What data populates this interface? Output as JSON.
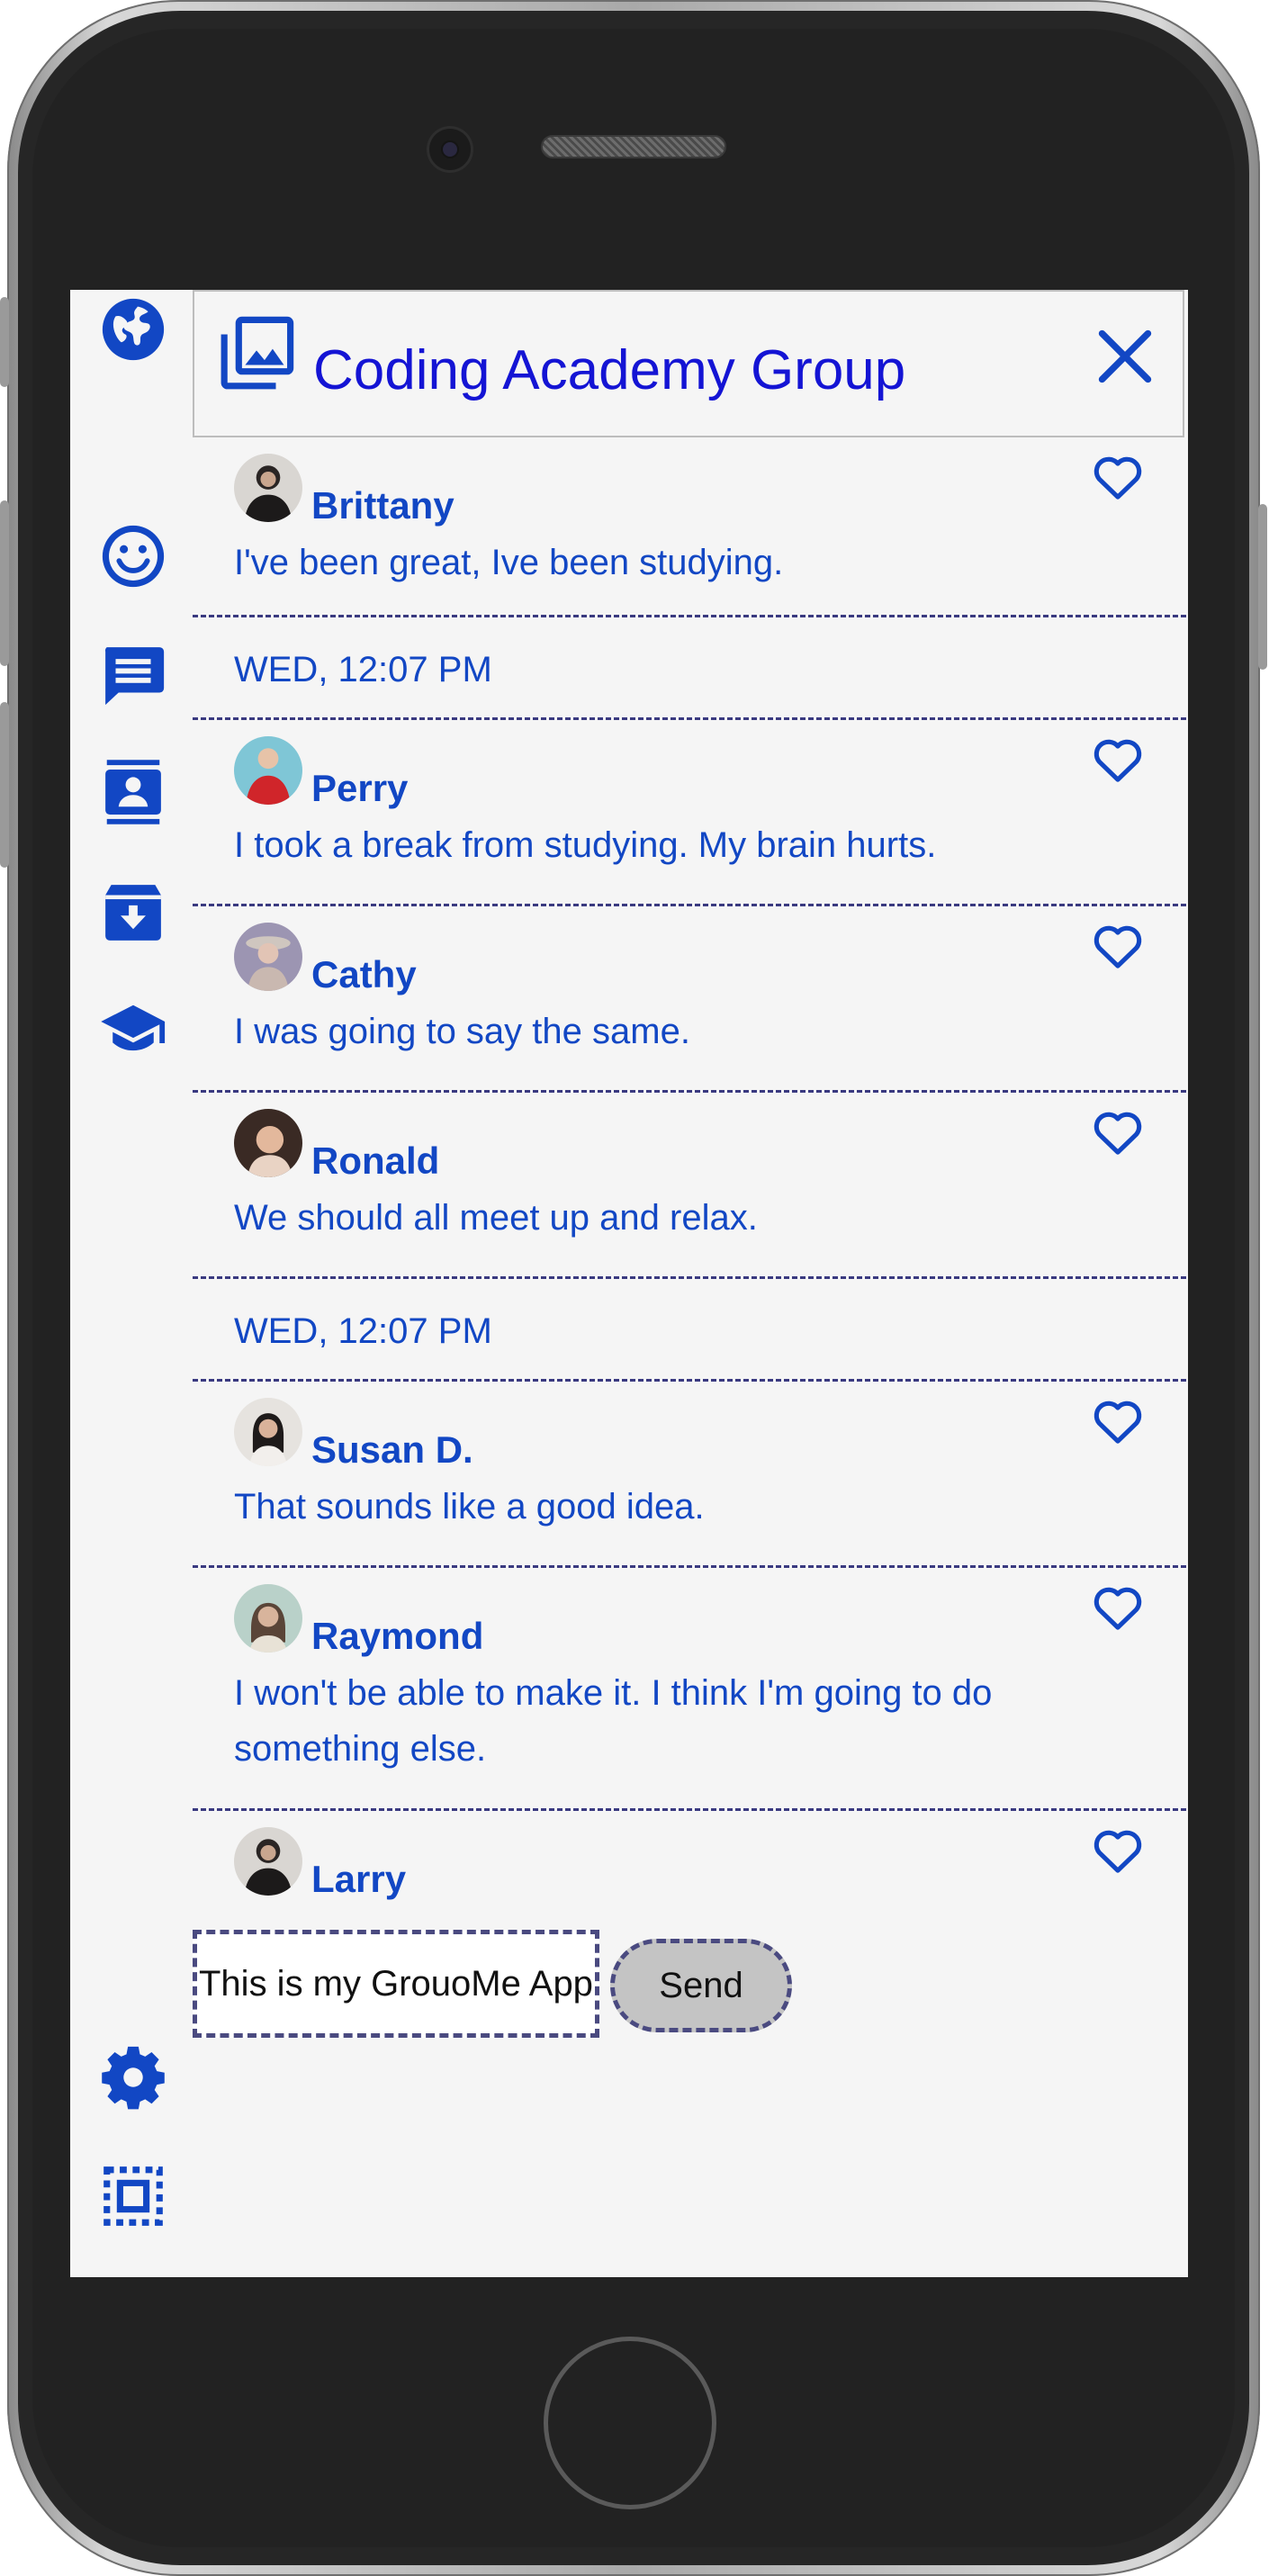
{
  "header": {
    "title": "Coding Academy Group"
  },
  "sidebar": {
    "items": [
      {
        "icon": "globe-icon"
      },
      {
        "icon": "smiley-icon"
      },
      {
        "icon": "chat-icon"
      },
      {
        "icon": "contacts-icon"
      },
      {
        "icon": "archive-icon"
      },
      {
        "icon": "graduation-cap-icon"
      },
      {
        "icon": "gear-icon"
      },
      {
        "icon": "selection-icon"
      }
    ]
  },
  "colors": {
    "accent": "#1247c4",
    "title": "#1414d4",
    "background": "#f5f5f5",
    "divider": "#3a3a80"
  },
  "messages": [
    {
      "name": "Brittany",
      "text": "I've been great, Ive been studying."
    },
    {
      "timestamp": "WED, 12:07 PM"
    },
    {
      "name": "Perry",
      "text": "I took a break from studying. My brain hurts."
    },
    {
      "name": "Cathy",
      "text": "I was going to say the same."
    },
    {
      "name": "Ronald",
      "text": "We should all meet up and relax."
    },
    {
      "timestamp": "WED, 12:07 PM"
    },
    {
      "name": "Susan D.",
      "text": "That sounds like a good idea."
    },
    {
      "name": "Raymond",
      "text": "I won't be able to make it. I think I'm going to do something else."
    },
    {
      "name": "Larry",
      "text": ""
    }
  ],
  "composer": {
    "input_value": "This is my GrouoMe App",
    "send_label": "Send"
  }
}
